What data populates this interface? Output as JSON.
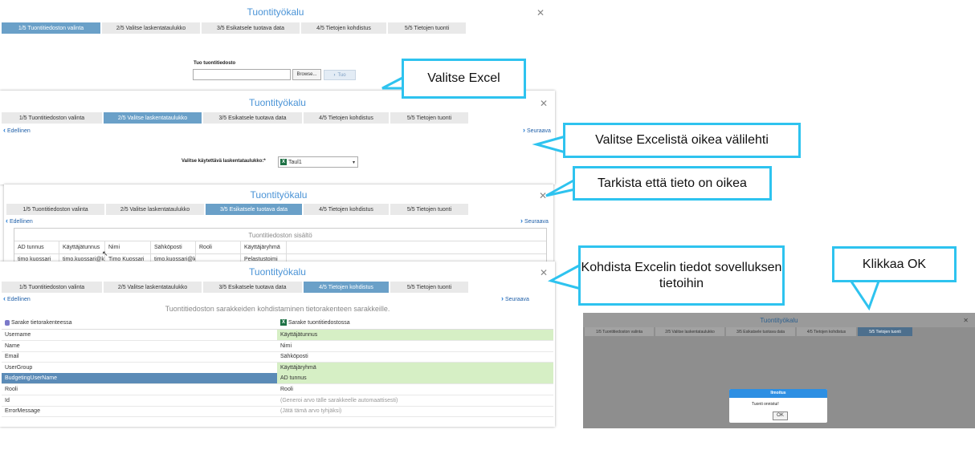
{
  "window_title": "Tuontityökalu",
  "tabs": [
    "1/5 Tuontitiedoston valinta",
    "2/5 Valitse laskentataulukko",
    "3/5 Esikatsele tuotava data",
    "4/5 Tietojen kohdistus",
    "5/5 Tietojen tuonti"
  ],
  "nav": {
    "prev": "Edellinen",
    "next": "Seuraava"
  },
  "step1": {
    "file_label": "Tuo tuontitiedosto",
    "file_value": "",
    "browse": "Browse...",
    "import": "Tuo"
  },
  "step2": {
    "sheet_label": "Valitse käytettävä laskentataulukko:*",
    "sheet_value": "Taul1"
  },
  "step3": {
    "caption": "Tuontitiedoston sisältö",
    "headers": [
      "AD tunnus",
      "Käyttäjätunnus",
      "Nimi",
      "Sähköposti",
      "Rooli",
      "Käyttäjäryhmä"
    ],
    "row": [
      "timo kuossari",
      "timo.kuossari@ks",
      "Timo Kuossari",
      "timo.kuossari@ks",
      "",
      "Pelastustoimi"
    ]
  },
  "step4": {
    "caption": "Tuontitiedoston sarakkeiden kohdistaminen tietorakenteen sarakkeille.",
    "col1": "Sarake tietorakenteessa",
    "col2": "Sarake tuontitiedostossa",
    "rows": [
      {
        "field": "Username",
        "source": "Käyttäjätunnus",
        "state": "mapped"
      },
      {
        "field": "Name",
        "source": "Nimi",
        "state": "plain"
      },
      {
        "field": "Email",
        "source": "Sähköposti",
        "state": "plain"
      },
      {
        "field": "UserGroup",
        "source": "Käyttäjäryhmä",
        "state": "mapped"
      },
      {
        "field": "BudgetingUserName",
        "source": "AD tunnus",
        "state": "selected"
      },
      {
        "field": "Rooli",
        "source": "Rooli",
        "state": "plain"
      },
      {
        "field": "Id",
        "source": "(Generoi arvo tälle sarakkeelle automaattisesti)",
        "state": "auto"
      },
      {
        "field": "ErrorMessage",
        "source": "(Jätä tämä arvo tyhjäksi)",
        "state": "auto"
      }
    ]
  },
  "step5": {
    "dialog_title": "Ilmoitus",
    "dialog_message": "Tuonti onnistui!",
    "ok": "OK"
  },
  "callouts": {
    "c1": "Valitse Excel",
    "c2": "Valitse Excelistä oikea välilehti",
    "c3": "Tarkista että tieto on oikea",
    "c4": "Kohdista Excelin tiedot sovelluksen tietoihin",
    "c5": "Klikkaa OK"
  },
  "colors": {
    "accent": "#2ec3ef",
    "active_tab": "#6aa0c8",
    "mapped": "#d6efc5",
    "selected": "#5b8bb7"
  }
}
